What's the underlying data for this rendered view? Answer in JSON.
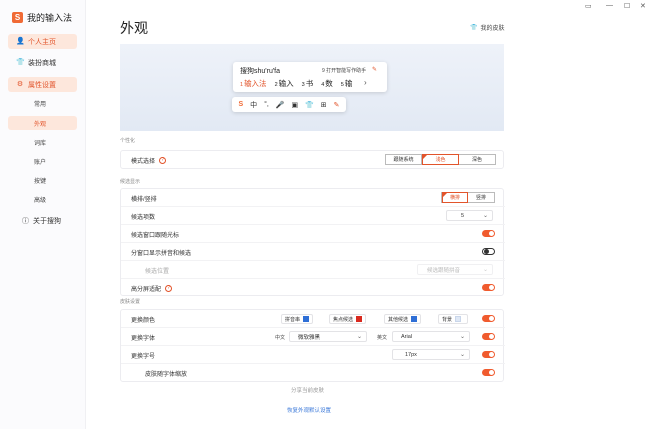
{
  "app": {
    "title": "我的输入法",
    "logo": "S"
  },
  "nav": {
    "profile": "个人主页",
    "store": "装扮商城",
    "settings": "属性设置",
    "sub": [
      "常用",
      "外观",
      "词库",
      "账户",
      "按键",
      "高级"
    ],
    "about": "关于搜狗"
  },
  "window": {
    "controls": [
      "▭",
      "—",
      "☐",
      "✕"
    ]
  },
  "page": {
    "title": "外观",
    "my_skin": "我的皮肤"
  },
  "preview": {
    "code": "搜狗shu'ru'fa",
    "tip": "9 打开智能写作助手",
    "candidates": [
      {
        "num": "1",
        "text": "输入法"
      },
      {
        "num": "2",
        "text": "输入"
      },
      {
        "num": "3",
        "text": "书"
      },
      {
        "num": "4",
        "text": "数"
      },
      {
        "num": "5",
        "text": "输"
      }
    ],
    "more": "›",
    "toolbar": [
      "S",
      "中",
      "°,",
      "🎤",
      "▣",
      "👕",
      "⊞",
      "✎"
    ]
  },
  "sections": {
    "personal": "个性化",
    "candidate": "候选显示",
    "skin": "皮肤设置"
  },
  "mode": {
    "label": "模式选择",
    "options": [
      "跟随系统",
      "浅色",
      "深色"
    ],
    "selected": "浅色"
  },
  "candidate": {
    "layout_label": "横排/竖排",
    "layout_options": [
      "横排",
      "竖排"
    ],
    "layout_selected": "横排",
    "count_label": "候选项数",
    "count_value": "5",
    "follow_label": "候选窗口跟随光标",
    "split_label": "分窗口显示拼音和候选",
    "position_label": "候选位置",
    "position_value": "候选跟随拼音",
    "hires_label": "高分屏适配"
  },
  "skin": {
    "color_label": "更换颜色",
    "chips": [
      {
        "label": "拼音串",
        "color": "#2f6fd6"
      },
      {
        "label": "焦点候选",
        "color": "#d92a1f"
      },
      {
        "label": "其他候选",
        "color": "#2f6fd6"
      },
      {
        "label": "背景",
        "color": "#dfe8f5"
      }
    ],
    "font_label": "更换字体",
    "cn_prefix": "中文",
    "cn_font": "微软雅黑",
    "en_prefix": "英文",
    "en_font": "Arial",
    "size_label": "更换字号",
    "size_value": "17px",
    "scale_label": "皮肤随字体缩放"
  },
  "footer": {
    "share": "分享当前皮肤",
    "restore": "恢复外观默认设置"
  },
  "colors": {
    "accent": "#f05b2e",
    "link": "#3a78d9"
  }
}
